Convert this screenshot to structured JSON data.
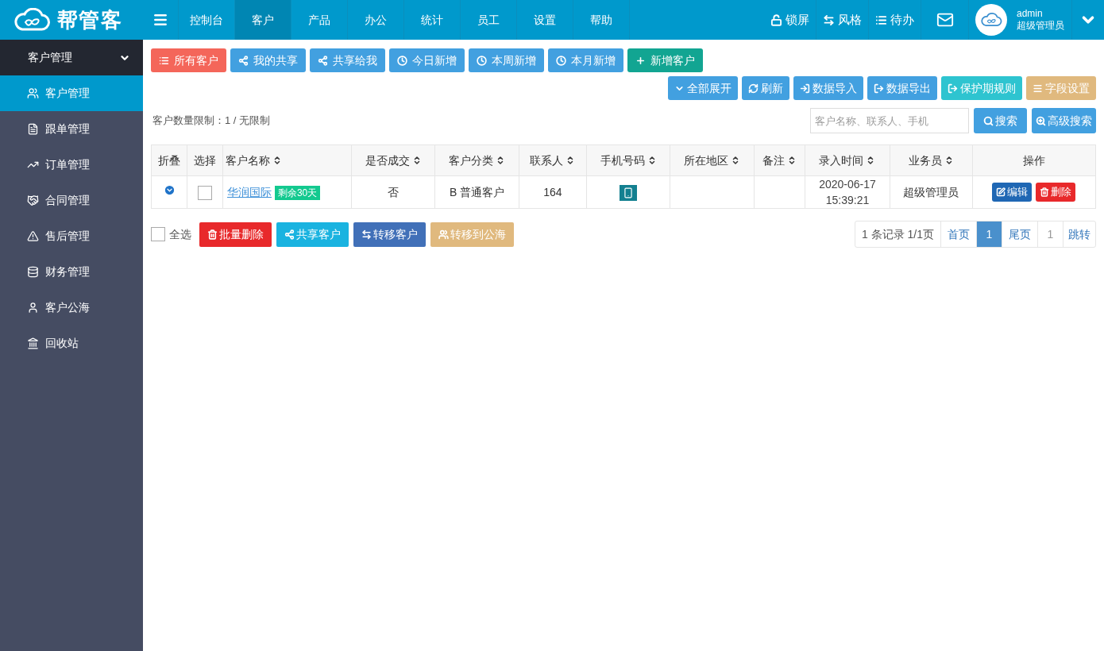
{
  "header": {
    "logo": "帮管客",
    "nav": [
      {
        "label": "控制台",
        "selected": false
      },
      {
        "label": "客户",
        "selected": true
      },
      {
        "label": "产品",
        "selected": false
      },
      {
        "label": "办公",
        "selected": false
      },
      {
        "label": "统计",
        "selected": false
      },
      {
        "label": "员工",
        "selected": false
      },
      {
        "label": "设置",
        "selected": false
      },
      {
        "label": "帮助",
        "selected": false
      }
    ],
    "tools": [
      "锁屏",
      "风格",
      "待办"
    ],
    "user": {
      "name": "admin",
      "role": "超级管理员"
    }
  },
  "sidebar": {
    "title": "客户管理",
    "expanded": true,
    "items": [
      {
        "label": "客户管理",
        "selected": true
      },
      {
        "label": "跟单管理",
        "selected": false
      },
      {
        "label": "订单管理",
        "selected": false
      },
      {
        "label": "合同管理",
        "selected": false
      },
      {
        "label": "售后管理",
        "selected": false
      },
      {
        "label": "财务管理",
        "selected": false
      },
      {
        "label": "客户公海",
        "selected": false
      },
      {
        "label": "回收站",
        "selected": false
      }
    ]
  },
  "filter_buttons": [
    {
      "label": "所有客户",
      "color": "#f4665a"
    },
    {
      "label": "我的共享",
      "color": "#42a0e0"
    },
    {
      "label": "共享给我",
      "color": "#42a0e0"
    },
    {
      "label": "今日新增",
      "color": "#42a0e0"
    },
    {
      "label": "本周新增",
      "color": "#42a0e0"
    },
    {
      "label": "本月新增",
      "color": "#42a0e0"
    },
    {
      "label": "新增客户",
      "color": "#12a592"
    }
  ],
  "tool_buttons": [
    {
      "label": "全部展开",
      "color": "#42a0e0"
    },
    {
      "label": "刷新",
      "color": "#42a0e0"
    },
    {
      "label": "数据导入",
      "color": "#42a0e0"
    },
    {
      "label": "数据导出",
      "color": "#42a0e0"
    },
    {
      "label": "保护期规则",
      "color": "#2ec4d0"
    },
    {
      "label": "字段设置",
      "color": "#e0b97e"
    }
  ],
  "limit_text": "客户数量限制：1 / 无限制",
  "search": {
    "placeholder": "客户名称、联系人、手机",
    "button": "搜索",
    "advanced": "高级搜索"
  },
  "table": {
    "columns": [
      {
        "label": "折叠",
        "sortable": false
      },
      {
        "label": "选择",
        "sortable": false
      },
      {
        "label": "客户名称",
        "sortable": true
      },
      {
        "label": "是否成交",
        "sortable": true
      },
      {
        "label": "客户分类",
        "sortable": true
      },
      {
        "label": "联系人",
        "sortable": true
      },
      {
        "label": "手机号码",
        "sortable": true
      },
      {
        "label": "所在地区",
        "sortable": true
      },
      {
        "label": "备注",
        "sortable": true
      },
      {
        "label": "录入时间",
        "sortable": true
      },
      {
        "label": "业务员",
        "sortable": true
      },
      {
        "label": "操作",
        "sortable": false
      }
    ],
    "rows": [
      {
        "expanded": false,
        "checked": false,
        "name": "华润国际",
        "badge": "剩余30天",
        "deal": "否",
        "category": "B 普通客户",
        "contact": "164",
        "date": "2020-06-17",
        "time": "15:39:21",
        "salesman": "超级管理员",
        "actions": [
          "编辑",
          "删除"
        ]
      }
    ]
  },
  "bulk": {
    "select_all": {
      "label": "全选",
      "checked": false
    },
    "buttons": [
      {
        "label": "批量删除",
        "color": "#e8292b"
      },
      {
        "label": "共享客户",
        "color": "#1ab3e0"
      },
      {
        "label": "转移客户",
        "color": "#4170b8"
      },
      {
        "label": "转移到公海",
        "color": "#e0b97e"
      }
    ]
  },
  "pagination": {
    "info": "1 条记录 1/1页",
    "first": "首页",
    "pages": [
      {
        "label": "1",
        "selected": true
      }
    ],
    "last": "尾页",
    "jump_value": "1",
    "jump": "跳转"
  }
}
